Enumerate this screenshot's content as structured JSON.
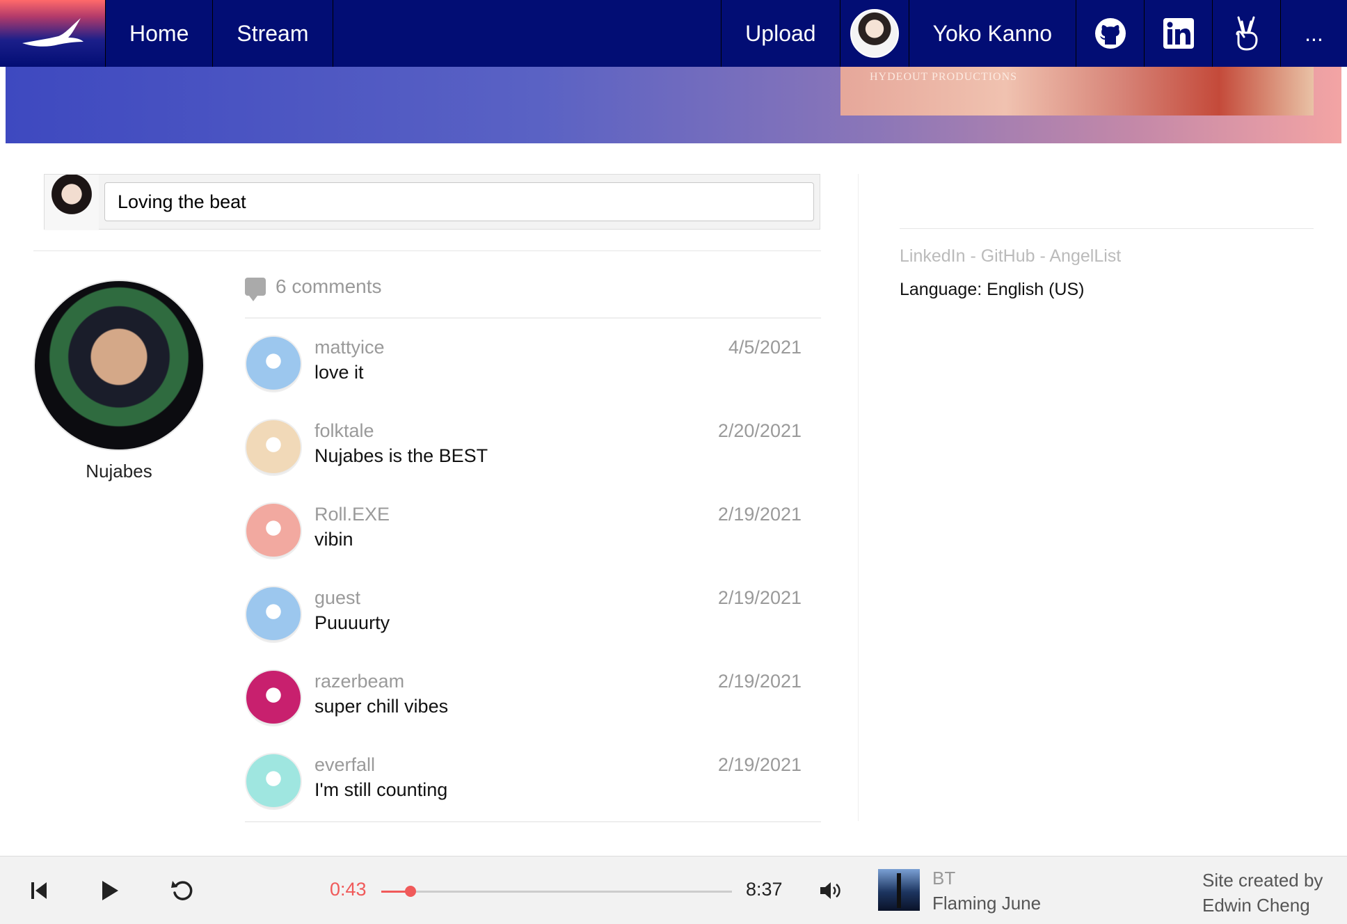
{
  "nav": {
    "home": "Home",
    "stream": "Stream",
    "upload": "Upload",
    "user_name": "Yoko Kanno",
    "more": "...",
    "icons": [
      "bird-logo-icon",
      "github-icon",
      "linkedin-icon",
      "angellist-icon"
    ]
  },
  "banner": {
    "image_text": "HYDEOUT PRODUCTIONS"
  },
  "composer": {
    "value": "Loving the beat"
  },
  "artist": {
    "name": "Nujabes"
  },
  "comments": {
    "header": "6 comments",
    "items": [
      {
        "user": "mattyice",
        "text": "love it",
        "date": "4/5/2021",
        "avatar_color": "#9cc7ee"
      },
      {
        "user": "folktale",
        "text": "Nujabes is the BEST",
        "date": "2/20/2021",
        "avatar_color": "#f1d9b8"
      },
      {
        "user": "Roll.EXE",
        "text": "vibin",
        "date": "2/19/2021",
        "avatar_color": "#f2a9a0"
      },
      {
        "user": "guest",
        "text": "Puuuurty",
        "date": "2/19/2021",
        "avatar_color": "#9cc7ee"
      },
      {
        "user": "razerbeam",
        "text": "super chill vibes",
        "date": "2/19/2021",
        "avatar_color": "#c8206e"
      },
      {
        "user": "everfall",
        "text": "I'm still counting",
        "date": "2/19/2021",
        "avatar_color": "#9fe6e0"
      }
    ]
  },
  "sidebar": {
    "links": "LinkedIn - GitHub - AngelList",
    "language": "Language: English (US)"
  },
  "player": {
    "current_time": "0:43",
    "total_time": "8:37",
    "progress": 0.083,
    "artist": "BT",
    "title": "Flaming June",
    "credit_line1": "Site created by",
    "credit_line2": "Edwin Cheng",
    "accent": "#f05a5a"
  }
}
